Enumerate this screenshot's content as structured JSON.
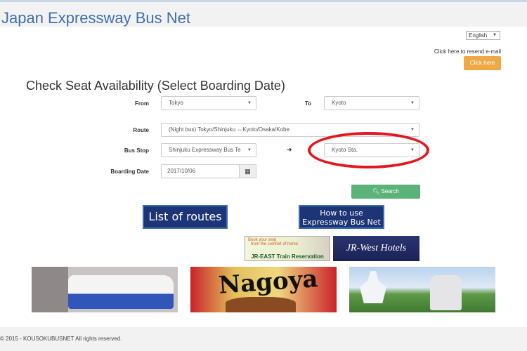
{
  "header": {
    "brand": "Japan Expressway Bus Net"
  },
  "language": {
    "selected": "English"
  },
  "resend": {
    "text": "Click here to resend e-mail",
    "button": "Click here"
  },
  "form": {
    "title": "Check Seat Availability (Select Boarding Date)",
    "from_label": "From",
    "from_value": "Tokyo",
    "to_label": "To",
    "to_value": "Kyoto",
    "route_label": "Route",
    "route_value": "(Night bus) Tokyo/Shinjuku ⇔Kyoto/Osaka/Kobe",
    "busstop_label": "Bus Stop",
    "busstop_from": "Shinjuku Expressway Bus Te",
    "busstop_arrow": "➜",
    "busstop_to": "Kyoto Sta.",
    "date_label": "Boarding Date",
    "date_value": "2017/10/06",
    "search_label": "Search"
  },
  "banners": {
    "routes": "List of routes",
    "howto_line1": "How to use",
    "howto_line2": "Expressway Bus Net",
    "jreast_line1": "Book your seat",
    "jreast_line2": "from the comfort of home",
    "jreast_title": "JR-EAST Train Reservation",
    "jrwest": "JR-West Hotels",
    "nagoya": "Nagoya"
  },
  "footer": {
    "text": "© 2015 - KOUSOKUBUSNET All rights reserved."
  },
  "colors": {
    "brand": "#3e6fae",
    "orange": "#eea844",
    "green": "#5cb37a",
    "navy": "#1d3577",
    "highlight": "#e5161c"
  }
}
